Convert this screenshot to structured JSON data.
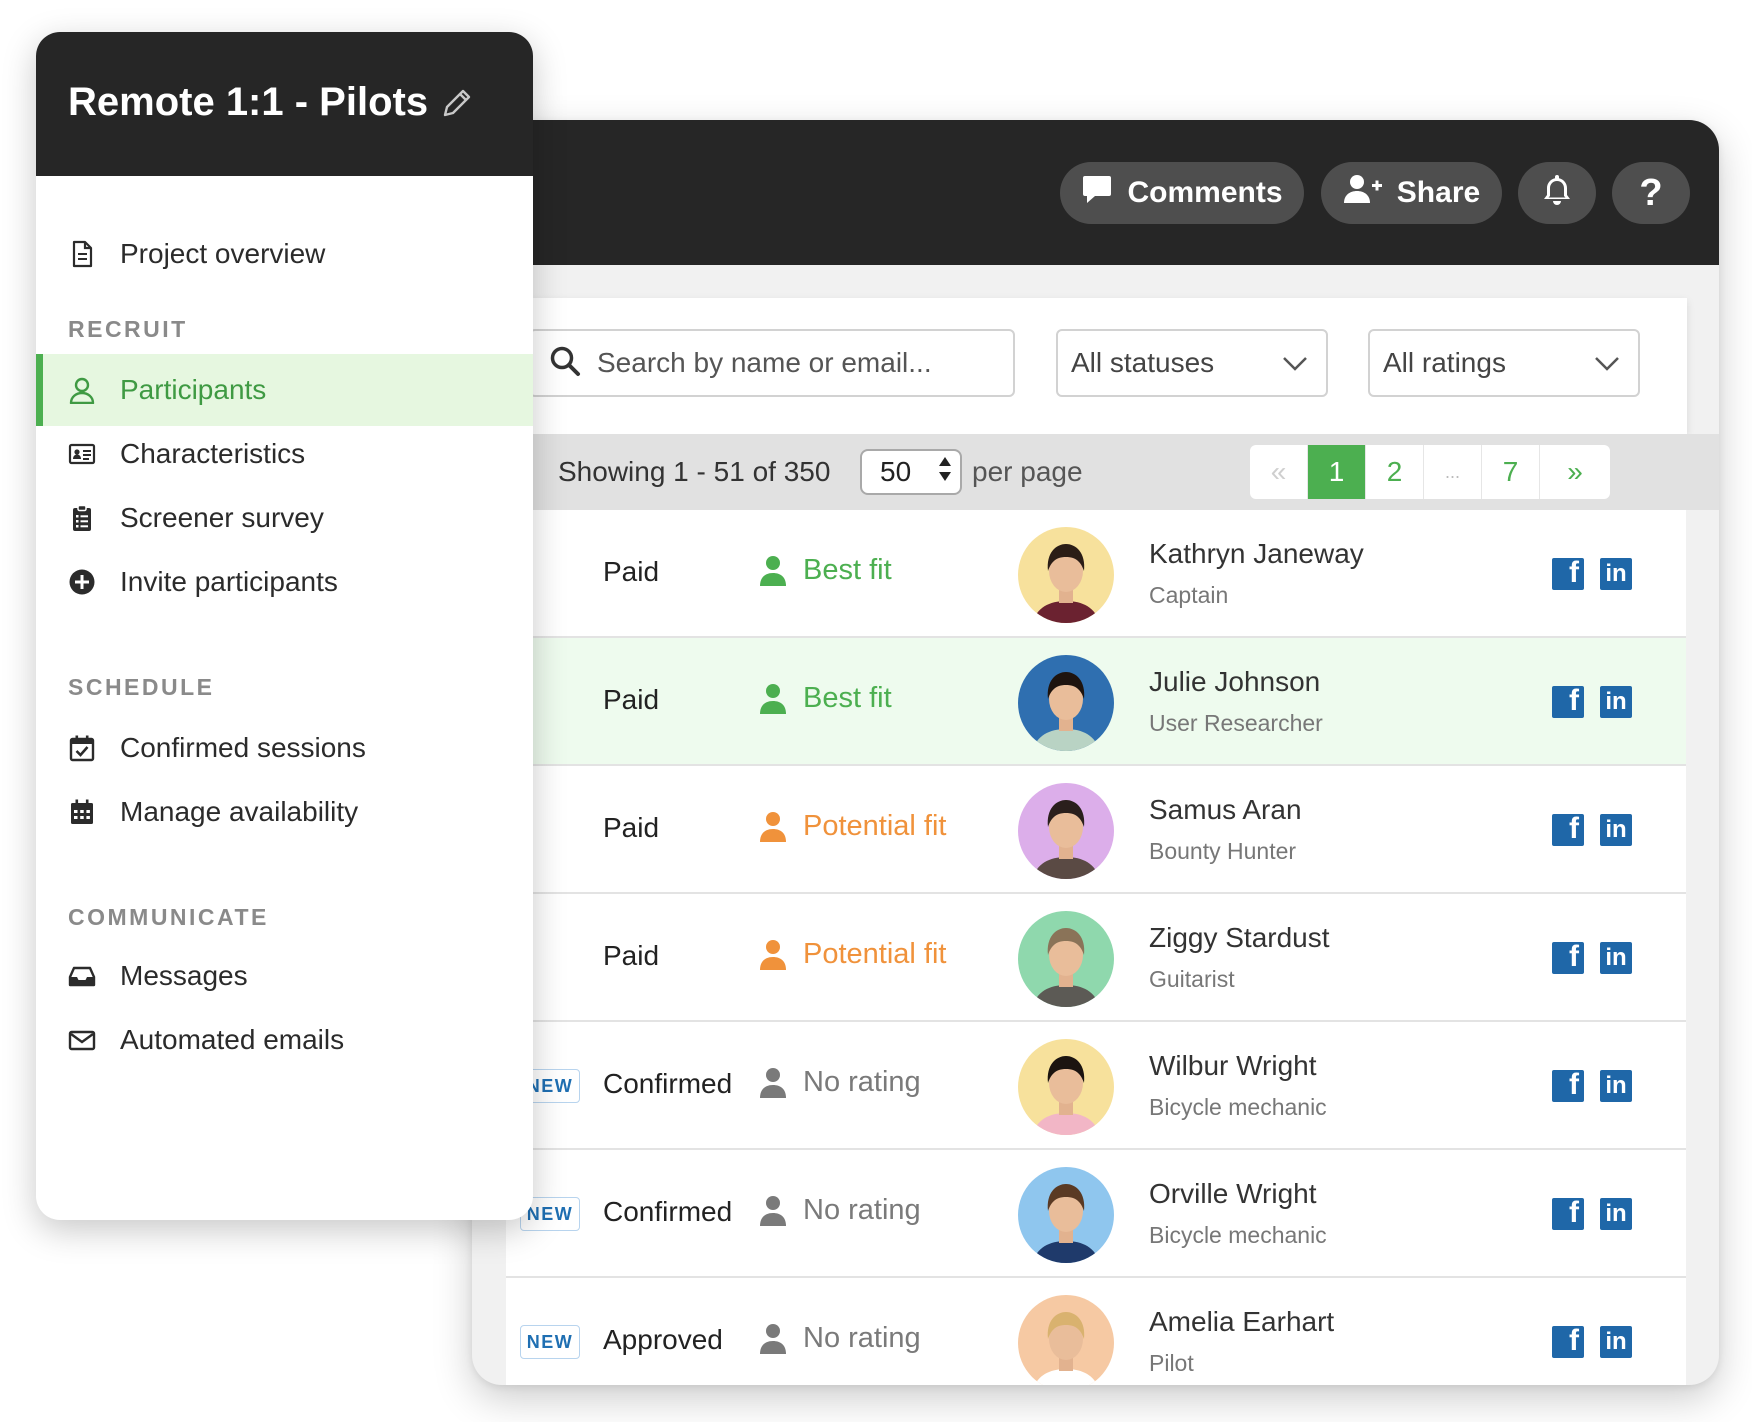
{
  "sidebar": {
    "title": "Remote 1:1 - Pilots",
    "overview": "Project overview",
    "sections": {
      "recruit": "RECRUIT",
      "schedule": "SCHEDULE",
      "communicate": "COMMUNICATE"
    },
    "items": {
      "participants": "Participants",
      "characteristics": "Characteristics",
      "screener": "Screener survey",
      "invite": "Invite participants",
      "confirmed": "Confirmed sessions",
      "availability": "Manage availability",
      "messages": "Messages",
      "automated": "Automated emails"
    }
  },
  "topbar": {
    "comments": "Comments",
    "share": "Share",
    "help": "?"
  },
  "filters": {
    "search_placeholder": "Search by name or email...",
    "status": "All statuses",
    "rating": "All ratings"
  },
  "pagination": {
    "showing": "Showing 1 - 51 of 350",
    "per_page_value": "50",
    "per_page_label": "per page",
    "first": "«",
    "pages": [
      "1",
      "2",
      "...",
      "7"
    ],
    "last": "»",
    "current": "1"
  },
  "colors": {
    "accent_green": "#4caf50",
    "potential_orange": "#f0923b",
    "no_rating_gray": "#7a7a7a",
    "social_blue": "#1f67a8"
  },
  "participants": [
    {
      "new": "",
      "status": "Paid",
      "rating": "Best fit",
      "rating_kind": "best",
      "name": "Kathryn Janeway",
      "role": "Captain",
      "avatar_bg": "#f7e19c",
      "hair": "#2b1d16",
      "shirt": "#6b2230",
      "highlight": false
    },
    {
      "new": "",
      "status": "Paid",
      "rating": "Best fit",
      "rating_kind": "best",
      "name": "Julie Johnson",
      "role": "User Researcher",
      "avatar_bg": "#2f6fb0",
      "hair": "#1e140f",
      "shirt": "#b9d3c4",
      "highlight": true
    },
    {
      "new": "",
      "status": "Paid",
      "rating": "Potential fit",
      "rating_kind": "potential",
      "name": "Samus Aran",
      "role": "Bounty Hunter",
      "avatar_bg": "#dcaeea",
      "hair": "#2a1f1c",
      "shirt": "#5a4a44",
      "highlight": false
    },
    {
      "new": "",
      "status": "Paid",
      "rating": "Potential fit",
      "rating_kind": "potential",
      "name": "Ziggy Stardust",
      "role": "Guitarist",
      "avatar_bg": "#8fd8ad",
      "hair": "#8a7358",
      "shirt": "#5c5a55",
      "highlight": false
    },
    {
      "new": "NEW",
      "status": "Confirmed",
      "rating": "No rating",
      "rating_kind": "none",
      "name": "Wilbur Wright",
      "role": "Bicycle mechanic",
      "avatar_bg": "#f7e19c",
      "hair": "#1b1410",
      "shirt": "#f2b6c6",
      "highlight": false
    },
    {
      "new": "NEW",
      "status": "Confirmed",
      "rating": "No rating",
      "rating_kind": "none",
      "name": "Orville Wright",
      "role": "Bicycle mechanic",
      "avatar_bg": "#8fc6ee",
      "hair": "#5a3a24",
      "shirt": "#1f3a6b",
      "highlight": false
    },
    {
      "new": "NEW",
      "status": "Approved",
      "rating": "No rating",
      "rating_kind": "none",
      "name": "Amelia Earhart",
      "role": "Pilot",
      "avatar_bg": "#f6c9a3",
      "hair": "#d9b26f",
      "shirt": "#ffffff",
      "highlight": false
    }
  ],
  "social": {
    "facebook": "f",
    "linkedin": "in"
  }
}
